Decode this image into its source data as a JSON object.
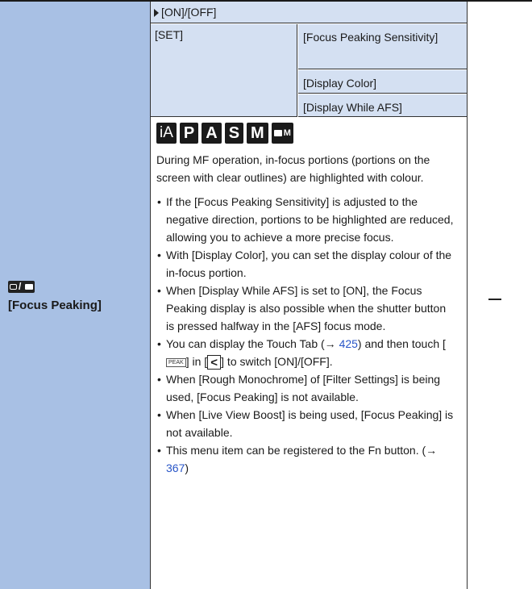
{
  "feature": {
    "name": "[Focus Peaking]",
    "icon": "photo-movie-mode-icon"
  },
  "settings": {
    "onoff": "[ON]/[OFF]",
    "set_label": "[SET]",
    "sub_items": [
      "[Focus Peaking Sensitivity]",
      "[Display Color]",
      "[Display While AFS]"
    ]
  },
  "modes": [
    "iA",
    "P",
    "A",
    "S",
    "M",
    "M"
  ],
  "description": "During MF operation, in-focus portions (portions on the screen with clear outlines) are highlighted with colour.",
  "notes": {
    "n1": "If the [Focus Peaking Sensitivity] is adjusted to the negative direction, portions to be highlighted are reduced, allowing you to achieve a more precise focus.",
    "n2": "With [Display Color], you can set the display colour of the in-focus portion.",
    "n3": "When [Display While AFS] is set to [ON], the Focus Peaking display is also possible when the shutter button is pressed halfway in the [AFS] focus mode.",
    "n4_a": "You can display the Touch Tab (",
    "n4_page": "425",
    "n4_b": ") and then touch [",
    "n4_peak": "PEAK",
    "n4_c": "] in [",
    "n4_d": "] to switch [ON]/[OFF].",
    "n5": "When [Rough Monochrome] of [Filter Settings] is being used, [Focus Peaking] is not available.",
    "n6": "When [Live View Boost] is being used, [Focus Peaking] is not available.",
    "n7_a": "This menu item can be registered to the Fn button. (",
    "n7_page": "367",
    "n7_b": ")"
  },
  "arrow_symbol": "→",
  "default_value": "—",
  "colors": {
    "header_blue": "#a8c0e4",
    "cell_blue": "#d4e0f2",
    "link": "#2855c7"
  }
}
